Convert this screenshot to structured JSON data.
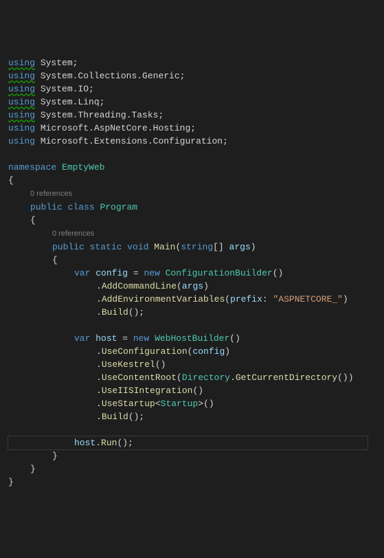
{
  "using": [
    "System;",
    "System.Collections.Generic;",
    "System.IO;",
    "System.Linq;",
    "System.Threading.Tasks;",
    "Microsoft.AspNetCore.Hosting;",
    "Microsoft.Extensions.Configuration;"
  ],
  "using_kw": "using",
  "namespace_kw": "namespace",
  "namespace_name": "EmptyWeb",
  "open_brace": "{",
  "close_brace": "}",
  "refs": {
    "class": "0 references",
    "main": "0 references"
  },
  "cls": {
    "public": "public",
    "class": "class",
    "name": "Program"
  },
  "main": {
    "public": "public",
    "static": "static",
    "void": "void",
    "name": "Main",
    "lparen": "(",
    "argtype": "string",
    "brackets": "[]",
    "argname": "args",
    "rparen": ")"
  },
  "cfg": {
    "var": "var",
    "name": "config",
    "eq": " = ",
    "new": "new",
    "builder": "ConfigurationBuilder",
    "parens": "()",
    "dot": ".",
    "addCommandLine": "AddCommandLine",
    "args_open": "(",
    "args_name": "args",
    "args_close": ")",
    "addEnv": "AddEnvironmentVariables",
    "env_open": "(",
    "prefix_lbl": "prefix",
    "colon": ": ",
    "prefix_val": "\"ASPNETCORE_\"",
    "env_close": ")",
    "build": "Build",
    "build_end": "();"
  },
  "host": {
    "var": "var",
    "name": "host",
    "eq": " = ",
    "new": "new",
    "builder": "WebHostBuilder",
    "parens": "()",
    "dot": ".",
    "useConfig": "UseConfiguration",
    "useConfig_open": "(",
    "useConfig_arg": "config",
    "useConfig_close": ")",
    "useKestrel": "UseKestrel",
    "useKestrel_end": "()",
    "useContentRoot": "UseContentRoot",
    "ucr_open": "(",
    "directory": "Directory",
    "getCurrentDir": "GetCurrentDirectory",
    "gcd_end": "()",
    "ucr_close": ")",
    "useIIS": "UseIISIntegration",
    "useIIS_end": "()",
    "useStartup": "UseStartup",
    "lt": "<",
    "startup": "Startup",
    "gt": ">",
    "useStartup_end": "()",
    "build": "Build",
    "build_end": "();"
  },
  "run": {
    "host": "host",
    "dot": ".",
    "run": "Run",
    "end": "();"
  }
}
